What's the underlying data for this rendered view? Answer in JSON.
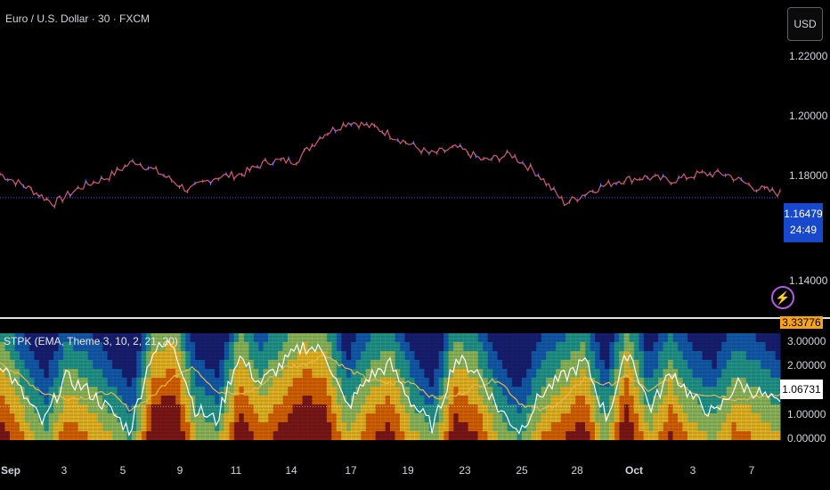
{
  "header": {
    "symbol_title": "Euro / U.S. Dollar · 30 · FXCM",
    "currency_button": "USD"
  },
  "price_axis": {
    "ticks": [
      "1.22000",
      "1.20000",
      "1.18000",
      "1.14000"
    ],
    "last_price": "1.16479",
    "countdown": "24:49"
  },
  "indicator": {
    "title": "STPK (EMA, Theme 3, 10, 2, 21, 20)",
    "axis_ticks": [
      "3.00000",
      "2.00000",
      "1.00000",
      "0.00000"
    ],
    "value_badge": "1.06731",
    "top_badge": "3.33776"
  },
  "time_axis": {
    "labels": [
      "Sep",
      "3",
      "5",
      "9",
      "11",
      "14",
      "17",
      "19",
      "23",
      "25",
      "28",
      "Oct",
      "3",
      "7"
    ],
    "bold": [
      "Sep",
      "Oct"
    ]
  },
  "colors": {
    "price_candle": "#d05a7a",
    "price_candle_alt": "#6c7cff",
    "indicator_line": "#ffffff",
    "signal_line": "#e8b84a",
    "last_price_badge": "#1848cc",
    "top_badge": "#f7a21b"
  },
  "chart_data": {
    "type": "line",
    "title": "Euro / U.S. Dollar · 30 · FXCM",
    "ylim": [
      1.13,
      1.225
    ],
    "y_ticks": [
      1.22,
      1.2,
      1.18,
      1.14
    ],
    "last_price": 1.16479,
    "x": [
      "Sep",
      "3",
      "5",
      "9",
      "11",
      "14",
      "17",
      "19",
      "23",
      "25",
      "28",
      "Oct",
      "3",
      "7"
    ],
    "series": [
      {
        "values": [
          1.172,
          1.168,
          1.163,
          1.168,
          1.171,
          1.176,
          1.172,
          1.167,
          1.171,
          1.172,
          1.176,
          1.176,
          1.184,
          1.188,
          1.186,
          1.182,
          1.178,
          1.18,
          1.176,
          1.178,
          1.172,
          1.163,
          1.167,
          1.17,
          1.171,
          1.17,
          1.172,
          1.172,
          1.168,
          1.166
        ]
      }
    ],
    "indicator": {
      "ylim": [
        0,
        3.4
      ],
      "ticks": [
        0,
        1,
        2,
        3
      ],
      "values": [
        2.5,
        1.5,
        0.5,
        2.0,
        1.6,
        1.0,
        0.3,
        2.8,
        3.1,
        1.0,
        0.6,
        2.7,
        1.8,
        2.4,
        3.0,
        2.8,
        1.0,
        2.0,
        2.4,
        1.2,
        0.4,
        2.6,
        2.2,
        1.0,
        0.3,
        1.5,
        2.0,
        2.5,
        0.7,
        2.9,
        1.0,
        2.2,
        1.3,
        0.8,
        1.8,
        1.5,
        1.07
      ]
    }
  }
}
